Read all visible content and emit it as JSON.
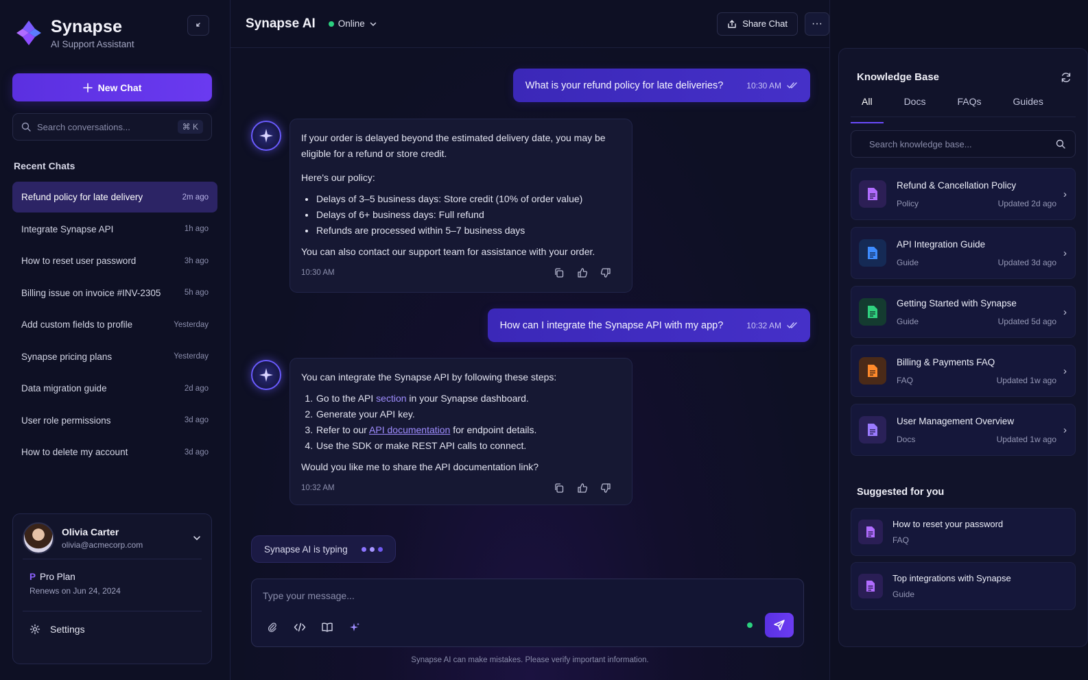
{
  "brand": {
    "name": "Synapse",
    "subtitle": "AI Support Assistant"
  },
  "sidebar": {
    "new_chat_label": "New Chat",
    "search_placeholder": "Search conversations...",
    "search_shortcut": "⌘ K",
    "recent_title": "Recent Chats",
    "chats": [
      {
        "label": "Refund policy for late delivery",
        "time": "2m ago",
        "active": true
      },
      {
        "label": "Integrate Synapse API",
        "time": "1h ago"
      },
      {
        "label": "How to reset user password",
        "time": "3h ago"
      },
      {
        "label": "Billing issue on invoice #INV-2305",
        "time": "5h ago"
      },
      {
        "label": "Add custom fields to profile",
        "time": "Yesterday"
      },
      {
        "label": "Synapse pricing plans",
        "time": "Yesterday"
      },
      {
        "label": "Data migration guide",
        "time": "2d ago"
      },
      {
        "label": "User role permissions",
        "time": "3d ago"
      },
      {
        "label": "How to delete my account",
        "time": "3d ago"
      }
    ],
    "user": {
      "name": "Olivia Carter",
      "email": "olivia@acmecorp.com"
    },
    "plan": {
      "badge": "P",
      "name": "Pro Plan",
      "renews": "Renews on Jun 24, 2024"
    },
    "settings_label": "Settings"
  },
  "header": {
    "title": "Synapse AI",
    "status": "Online",
    "share_label": "Share Chat",
    "more_label": "···"
  },
  "messages": {
    "user1": {
      "text": "What is your refund policy for late deliveries?",
      "time": "10:30 AM"
    },
    "bot1": {
      "intro": "If your order is delayed beyond the estimated delivery date, you may be eligible for a refund or store credit.",
      "policy_heading": "Here's our policy:",
      "bullets": [
        "Delays of 3–5 business days: Store credit (10% of order value)",
        "Delays of 6+ business days: Full refund",
        "Refunds are processed within 5–7 business days"
      ],
      "outro": "You can also contact our support team for assistance with your order.",
      "time": "10:30 AM"
    },
    "user2": {
      "text": "How can I integrate the Synapse API with my app?",
      "time": "10:32 AM"
    },
    "bot2": {
      "intro": "You can integrate the Synapse API by following these steps:",
      "step1_a": "Go to the API ",
      "step1_link": "section",
      "step1_b": " in your Synapse dashboard.",
      "step2": "Generate your API key.",
      "step3_a": "Refer to our ",
      "step3_link": "API documentation",
      "step3_b": " for endpoint details.",
      "step4": "Use the SDK or make REST API calls to connect.",
      "outro": "Would you like me to share the API documentation link?",
      "time": "10:32 AM"
    }
  },
  "typing": {
    "text": "Synapse AI is typing"
  },
  "composer": {
    "placeholder": "Type your message..."
  },
  "disclaimer": "Synapse AI can make mistakes. Please verify important information.",
  "knowledge_base": {
    "title": "Knowledge Base",
    "tabs": [
      "All",
      "Docs",
      "FAQs",
      "Guides"
    ],
    "search_placeholder": "Search knowledge base...",
    "items": [
      {
        "title": "Refund & Cancellation Policy",
        "type": "Policy",
        "updated": "Updated 2d ago",
        "color": "#b16cff",
        "bg": "#2c1f55"
      },
      {
        "title": "API Integration Guide",
        "type": "Guide",
        "updated": "Updated 3d ago",
        "color": "#3d8bff",
        "bg": "#152a55"
      },
      {
        "title": "Getting Started with Synapse",
        "type": "Guide",
        "updated": "Updated 5d ago",
        "color": "#2fd27e",
        "bg": "#143b30"
      },
      {
        "title": "Billing & Payments FAQ",
        "type": "FAQ",
        "updated": "Updated 1w ago",
        "color": "#ff8a2b",
        "bg": "#4a2a18"
      },
      {
        "title": "User Management Overview",
        "type": "Docs",
        "updated": "Updated 1w ago",
        "color": "#9b7bff",
        "bg": "#2a2158"
      }
    ],
    "suggested_title": "Suggested for you",
    "suggested": [
      {
        "title": "How to reset your password",
        "type": "FAQ"
      },
      {
        "title": "Top integrations with Synapse",
        "type": "Guide"
      }
    ]
  },
  "colors": {
    "accent": "#6236f0",
    "online": "#2bd07f",
    "background": "#0d0f21"
  }
}
